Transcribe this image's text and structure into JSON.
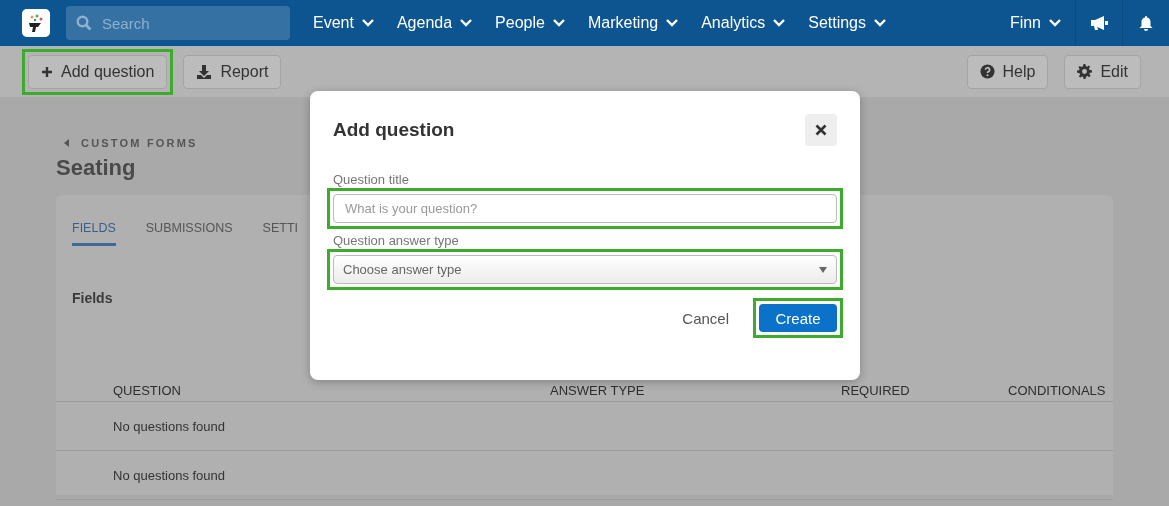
{
  "nav": {
    "search": {
      "placeholder": "Search"
    },
    "menus": [
      {
        "label": "Event"
      },
      {
        "label": "Agenda"
      },
      {
        "label": "People"
      },
      {
        "label": "Marketing"
      },
      {
        "label": "Analytics"
      },
      {
        "label": "Settings"
      }
    ],
    "user": "Finn"
  },
  "toolbar": {
    "left": [
      {
        "label": "Add question",
        "kind": "add",
        "highlighted": true
      },
      {
        "label": "Report",
        "kind": "report",
        "highlighted": false
      }
    ],
    "right": [
      {
        "label": "Help",
        "kind": "help",
        "highlighted": false
      },
      {
        "label": "Edit",
        "kind": "edit",
        "highlighted": false
      }
    ]
  },
  "breadcrumb": "CUSTOM FORMS",
  "title": "Seating",
  "tabs": [
    {
      "label": "FIELDS",
      "selected": true
    },
    {
      "label": "SUBMISSIONS",
      "selected": false
    },
    {
      "label": "SETTI",
      "selected": false
    }
  ],
  "section_title": "Fields",
  "table": {
    "columns": [
      "QUESTION",
      "ANSWER TYPE",
      "REQUIRED",
      "CONDITIONALS"
    ],
    "rows": [
      [
        "No questions found"
      ],
      [
        "No questions found"
      ]
    ]
  },
  "dialog": {
    "title": "Add question",
    "fields": [
      {
        "kind": "text",
        "label": "Question title",
        "placeholder": "What is your question?",
        "highlighted": true
      },
      {
        "kind": "select",
        "label": "Question answer type",
        "value": "Choose answer type",
        "highlighted": true
      }
    ],
    "buttons": [
      {
        "kind": "link",
        "label": "Cancel",
        "highlighted": false
      },
      {
        "kind": "primary",
        "label": "Create",
        "highlighted": true
      }
    ]
  }
}
